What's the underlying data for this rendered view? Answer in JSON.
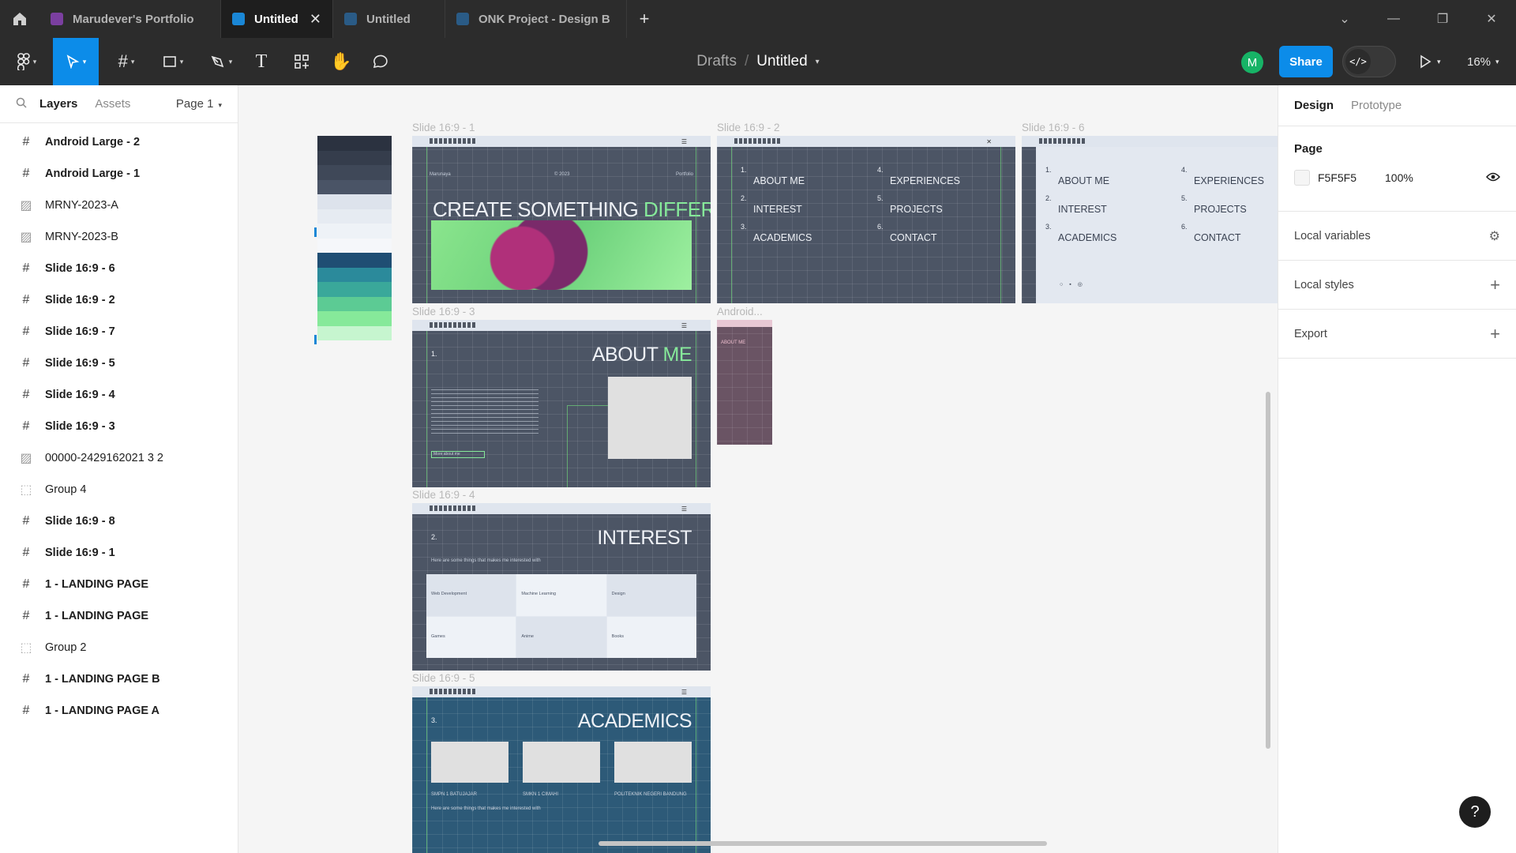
{
  "tabs": [
    {
      "label": "Marudever's Portfolio",
      "icon_color": "#7b3fa0",
      "active": false
    },
    {
      "label": "Untitled",
      "icon_color": "#1a87d6",
      "active": true,
      "close": "✕"
    },
    {
      "label": "Untitled",
      "icon_color": "#2a5b86",
      "active": false
    },
    {
      "label": "ONK Project - Design B",
      "icon_color": "#2a5b86",
      "active": false
    }
  ],
  "breadcrumb": {
    "folder": "Drafts",
    "separator": "/",
    "file": "Untitled"
  },
  "user_avatar": "M",
  "share_label": "Share",
  "dev_mode_label": "</>",
  "zoom_label": "16%",
  "left_panel": {
    "tab_layers": "Layers",
    "tab_assets": "Assets",
    "page_selector": "Page 1",
    "layers": [
      {
        "name": "Android Large - 2",
        "type": "frame"
      },
      {
        "name": "Android Large - 1",
        "type": "frame"
      },
      {
        "name": "MRNY-2023-A",
        "type": "image"
      },
      {
        "name": "MRNY-2023-B",
        "type": "image"
      },
      {
        "name": "Slide 16:9 - 6",
        "type": "frame"
      },
      {
        "name": "Slide 16:9 - 2",
        "type": "frame"
      },
      {
        "name": "Slide 16:9 - 7",
        "type": "frame"
      },
      {
        "name": "Slide 16:9 - 5",
        "type": "frame"
      },
      {
        "name": "Slide 16:9 - 4",
        "type": "frame"
      },
      {
        "name": "Slide 16:9 - 3",
        "type": "frame"
      },
      {
        "name": "00000-2429162021 3 2",
        "type": "image"
      },
      {
        "name": "Group 4",
        "type": "group"
      },
      {
        "name": "Slide 16:9 - 8",
        "type": "frame"
      },
      {
        "name": "Slide 16:9 - 1",
        "type": "frame"
      },
      {
        "name": "1 - LANDING PAGE",
        "type": "frame"
      },
      {
        "name": "1 - LANDING PAGE",
        "type": "frame"
      },
      {
        "name": "Group 2",
        "type": "group"
      },
      {
        "name": "1 - LANDING PAGE B",
        "type": "frame"
      },
      {
        "name": "1 - LANDING PAGE A",
        "type": "frame"
      }
    ]
  },
  "right_panel": {
    "tab_design": "Design",
    "tab_prototype": "Prototype",
    "page_title": "Page",
    "page_fill_hex": "F5F5F5",
    "page_fill_opacity": "100%",
    "local_variables": "Local variables",
    "local_styles": "Local styles",
    "export": "Export"
  },
  "help_label": "?",
  "canvas": {
    "frames": {
      "s1": {
        "label": "Slide 16:9 - 1",
        "headline": "CREATE SOMETHING ",
        "headline_accent": "DIFFERENT",
        "meta_left": "Marunaya",
        "meta_mid": "© 2023",
        "meta_right": "Portfolio"
      },
      "s2": {
        "label": "Slide 16:9 - 2",
        "close": "✕",
        "items": [
          "ABOUT ME",
          "INTEREST",
          "ACADEMICS",
          "EXPERIENCES",
          "PROJECTS",
          "CONTACT"
        ],
        "nums": [
          "1.",
          "2.",
          "3.",
          "4.",
          "5.",
          "6."
        ]
      },
      "s6": {
        "label": "Slide 16:9 - 6",
        "items": [
          "ABOUT ME",
          "INTEREST",
          "ACADEMICS",
          "EXPERIENCES",
          "PROJECTS",
          "CONTACT"
        ],
        "nums": [
          "1.",
          "2.",
          "3.",
          "4.",
          "5.",
          "6."
        ]
      },
      "s3": {
        "label": "Slide 16:9 - 3",
        "num": "1.",
        "title_a": "ABOUT ",
        "title_b": "ME",
        "button": "More about me"
      },
      "android": {
        "label": "Android...",
        "title": "ABOUT ME"
      },
      "s4": {
        "label": "Slide 16:9 - 4",
        "num": "2.",
        "title": "INTEREST",
        "subtitle": "Here are some things that makes me interested with",
        "cells": [
          "Web Development",
          "Machine Learning",
          "Design",
          "Games",
          "Anime",
          "Books"
        ]
      },
      "s5": {
        "label": "Slide 16:9 - 5",
        "num": "3.",
        "title": "ACADEMICS",
        "schools": [
          "SMPN 1 BATUJAJAR",
          "SMKN 1 CIMAHI",
          "POLITEKNIK NEGERI BANDUNG"
        ],
        "note": "Here are some things that makes me interested with"
      }
    },
    "palette_colors": [
      "#2b3240",
      "#353d4c",
      "#3f4858",
      "#4a5466",
      "#dde3ec",
      "#e6ebf2",
      "#eef2f7",
      "#f5f7fa",
      "#1f4e73",
      "#2b8a9b",
      "#3aa89a",
      "#5ccb94",
      "#86e99a",
      "#c6f5cf"
    ]
  }
}
